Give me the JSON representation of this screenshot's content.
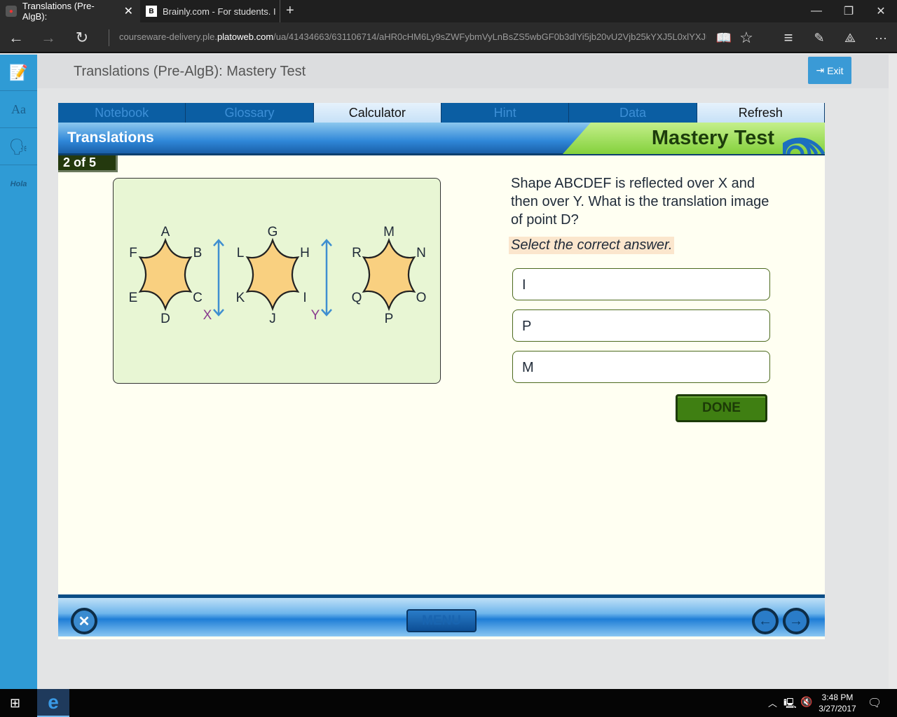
{
  "browser": {
    "tabs": [
      {
        "title": "Translations (Pre-AlgB):"
      },
      {
        "title": "Brainly.com - For students. I"
      }
    ],
    "url_prefix": "courseware-delivery.ple.",
    "url_domain": "platoweb.com",
    "url_rest": "/ua/41434663/631106714/aHR0cHM6Ly9sZWFybmVyLnBsZS5wbGF0b3dlYi5jb20vU2Vjb25kYXJ5L0xlYXJuaW"
  },
  "header": {
    "title": "Translations (Pre-AlgB): Mastery Test",
    "exit_label": "Exit"
  },
  "nav": {
    "items": [
      "Notebook",
      "Glossary",
      "Calculator",
      "Hint",
      "Data",
      "Refresh"
    ]
  },
  "banner": {
    "title": "Translations",
    "mode": "Mastery Test"
  },
  "counter": "2 of 5",
  "figure": {
    "shape1": [
      "A",
      "B",
      "C",
      "D",
      "E",
      "F"
    ],
    "shape2": [
      "G",
      "H",
      "I",
      "J",
      "K",
      "L"
    ],
    "shape3": [
      "M",
      "N",
      "O",
      "P",
      "Q",
      "R"
    ],
    "axis1": "X",
    "axis2": "Y",
    "fill_color": "#f9d080",
    "axis_color": "#3f8fd0",
    "axis_label_color": "#8a3d8f"
  },
  "question": {
    "text": "Shape ABCDEF is reflected over X and then over Y. What is the translation image of point D?",
    "instruction": "Select the correct answer.",
    "options": [
      "I",
      "P",
      "M"
    ],
    "done_label": "DONE"
  },
  "footer": {
    "menu_label": "MENU"
  },
  "taskbar": {
    "time": "3:48 PM",
    "date": "3/27/2017"
  }
}
